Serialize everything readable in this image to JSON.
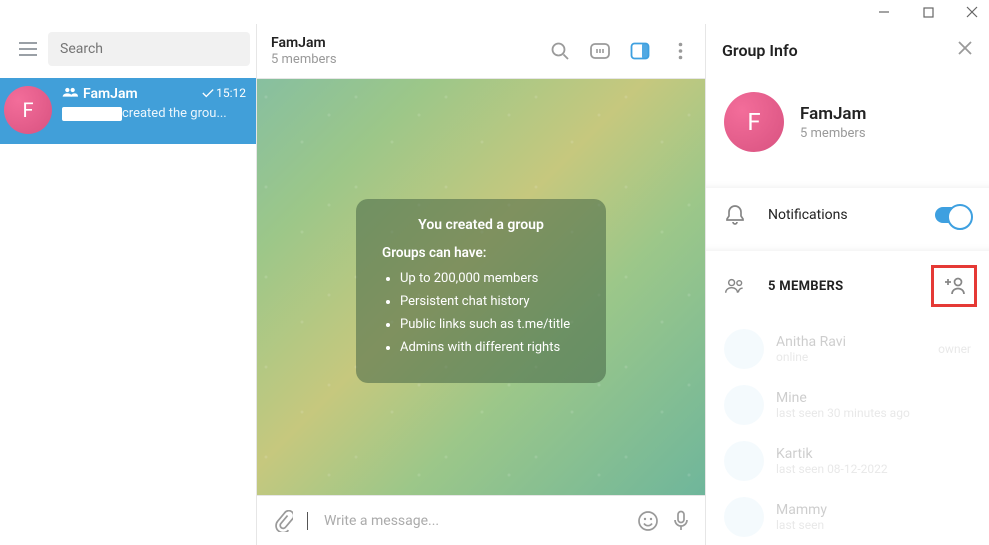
{
  "sidebar": {
    "search_placeholder": "Search",
    "chat": {
      "name": "FamJam",
      "preview_suffix": "created the grou...",
      "time": "15:12"
    }
  },
  "header": {
    "title": "FamJam",
    "subtitle": "5 members"
  },
  "notice": {
    "title": "You created a group",
    "subtitle": "Groups can have:",
    "points": [
      "Up to 200,000 members",
      "Persistent chat history",
      "Public links such as t.me/title",
      "Admins with different rights"
    ]
  },
  "composer": {
    "placeholder": "Write a message..."
  },
  "panel": {
    "title": "Group Info",
    "name": "FamJam",
    "subtitle": "5 members",
    "notifications_label": "Notifications",
    "members_label": "5 MEMBERS",
    "members": [
      {
        "name": "Anitha Ravi",
        "status": "online",
        "role": "owner"
      },
      {
        "name": "Mine",
        "status": "last seen 30 minutes ago",
        "role": ""
      },
      {
        "name": "Kartik",
        "status": "last seen 08-12-2022",
        "role": ""
      },
      {
        "name": "Mammy",
        "status": "last seen",
        "role": ""
      }
    ]
  },
  "avatar_letter": "F"
}
